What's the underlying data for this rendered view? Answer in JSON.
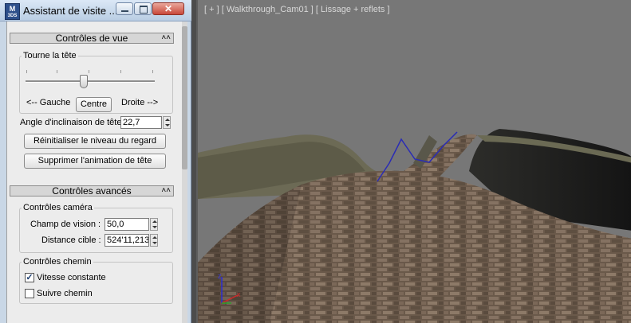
{
  "window": {
    "title": "Assistant de visite ...",
    "close_glyph": "✕",
    "app_icon_text": "M",
    "app_icon_sub": "3DS"
  },
  "view_controls": {
    "header": "Contrôles de vue",
    "group_label": "Tourne la tête",
    "left_label": "<-- Gauche",
    "center_button": "Centre",
    "right_label": "Droite -->",
    "tilt_label": "Angle d'inclinaison de tête",
    "tilt_value": "22,7",
    "reset_button": "Réinitialiser le niveau du regard",
    "delete_button": "Supprimer l'animation de tête",
    "slider_position": 0.45
  },
  "advanced_controls": {
    "header": "Contrôles avancés",
    "camera_group": "Contrôles caméra",
    "fov_label": "Champ de vision :",
    "fov_value": "50,0",
    "target_label": "Distance cible :",
    "target_value": "524'11,213",
    "path_group": "Contrôles chemin",
    "constant_speed_label": "Vitesse constante",
    "constant_speed_checked": true,
    "follow_path_label": "Suivre chemin",
    "follow_path_checked": false
  },
  "viewport": {
    "label": "[ + ] [ Walkthrough_Cam01 ] [ Lissage + reflets ]",
    "axis_x": "x",
    "axis_z": "z"
  },
  "colors": {
    "sky": "#7a7a7a",
    "road": "#6b5a48",
    "hill": "#6f6b55",
    "path_line": "#2a2cb5"
  }
}
